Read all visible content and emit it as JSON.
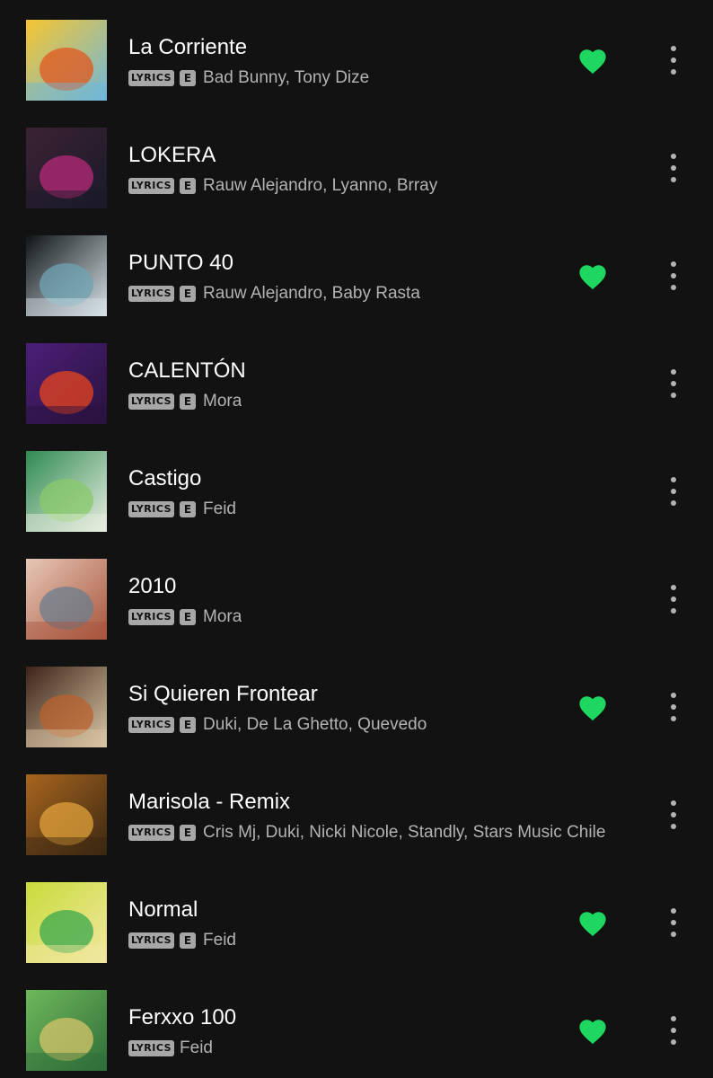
{
  "colors": {
    "background": "#121212",
    "liked": "#1ed760",
    "badge": "#a7a7a7",
    "secondary_text": "#b3b3b3"
  },
  "tracks": [
    {
      "title": "La Corriente",
      "lyrics": "LYRICS",
      "explicit": "E",
      "artists": "Bad Bunny, Tony Dize",
      "liked": true,
      "cover": [
        "#f7c531",
        "#e2571e",
        "#6fb8d9"
      ]
    },
    {
      "title": "LOKERA",
      "lyrics": "LYRICS",
      "explicit": "E",
      "artists": "Rauw Alejandro, Lyanno, Brray",
      "liked": false,
      "cover": [
        "#3b2233",
        "#b82a7a",
        "#1a1a2a"
      ]
    },
    {
      "title": "PUNTO 40",
      "lyrics": "LYRICS",
      "explicit": "E",
      "artists": "Rauw Alejandro, Baby Rasta",
      "liked": true,
      "cover": [
        "#0f1416",
        "#6fa3b3",
        "#d8e3e8"
      ]
    },
    {
      "title": "CALENTÓN",
      "lyrics": "LYRICS",
      "explicit": "E",
      "artists": "Mora",
      "liked": false,
      "cover": [
        "#4a1f78",
        "#e8441e",
        "#2a123f"
      ]
    },
    {
      "title": "Castigo",
      "lyrics": "LYRICS",
      "explicit": "E",
      "artists": "Feid",
      "liked": false,
      "cover": [
        "#2f8a52",
        "#8ac96b",
        "#e8eee0"
      ]
    },
    {
      "title": "2010",
      "lyrics": "LYRICS",
      "explicit": "E",
      "artists": "Mora",
      "liked": false,
      "cover": [
        "#e6c7b7",
        "#6b7e8e",
        "#a8553c"
      ]
    },
    {
      "title": "Si Quieren Frontear",
      "lyrics": "LYRICS",
      "explicit": "E",
      "artists": "Duki, De La Ghetto, Quevedo",
      "liked": true,
      "cover": [
        "#3b2418",
        "#b8612e",
        "#d9c6a5"
      ]
    },
    {
      "title": "Marisola - Remix",
      "lyrics": "LYRICS",
      "explicit": "E",
      "artists": "Cris Mj, Duki, Nicki Nicole, Standly, Stars Music Chile",
      "liked": false,
      "cover": [
        "#a8651e",
        "#e2a13b",
        "#3b2812"
      ]
    },
    {
      "title": "Normal",
      "lyrics": "LYRICS",
      "explicit": "E",
      "artists": "Feid",
      "liked": true,
      "cover": [
        "#c9dc3a",
        "#3aa84e",
        "#f1e6a0"
      ]
    },
    {
      "title": "Ferxxo 100",
      "lyrics": "LYRICS",
      "explicit": "",
      "artists": "Feid",
      "liked": true,
      "cover": [
        "#6fb85a",
        "#d7c46a",
        "#2f6e3a"
      ]
    }
  ]
}
